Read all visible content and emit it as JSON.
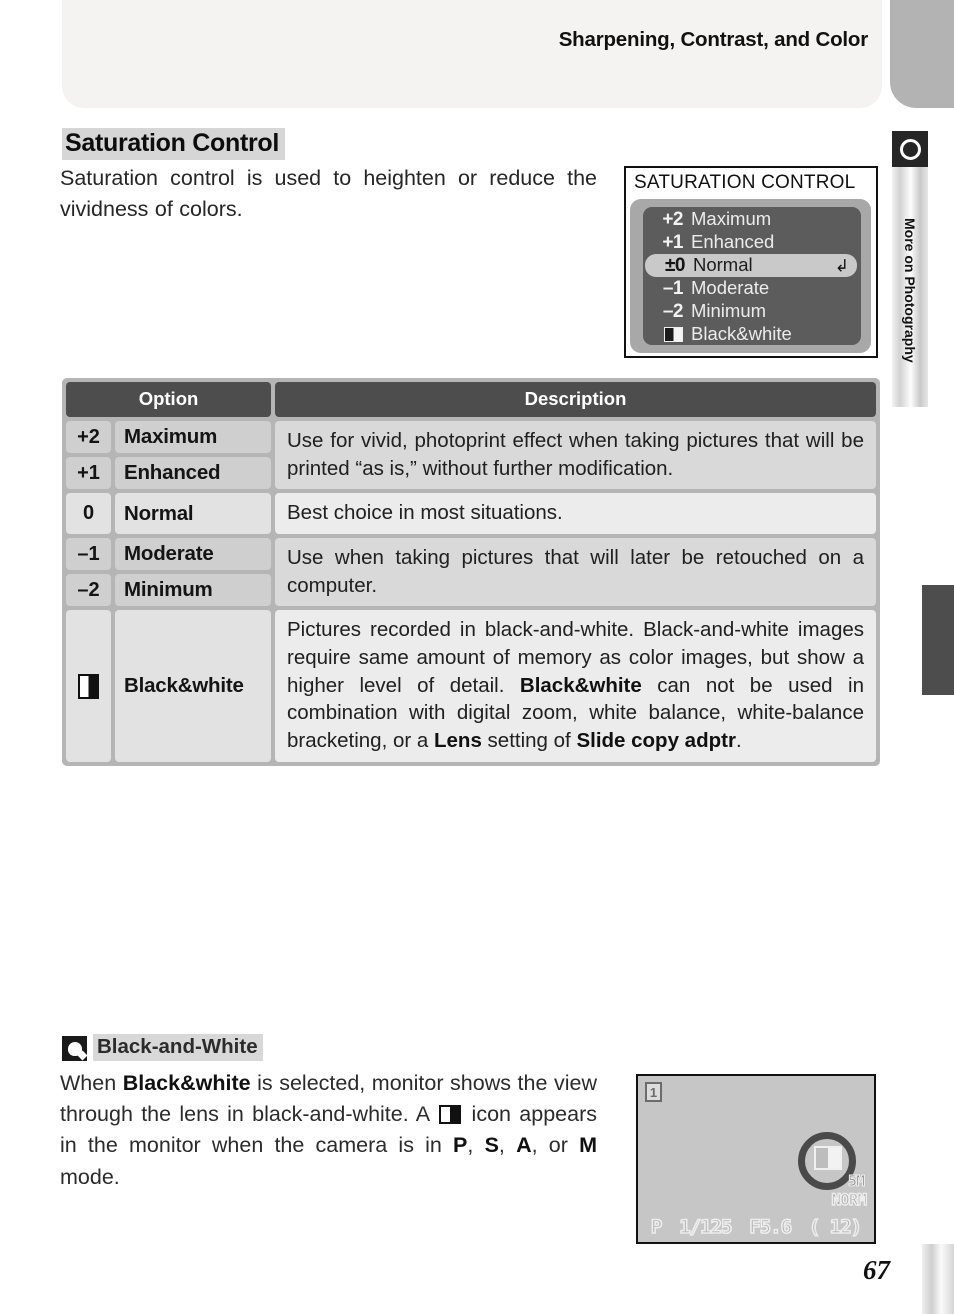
{
  "header": {
    "running_title": "Sharpening, Contrast, and Color"
  },
  "side_tab": {
    "label": "More on Photography",
    "icon": "lens-ring-icon"
  },
  "section": {
    "heading": "Saturation Control",
    "intro": "Saturation control is used to heighten or reduce the vividness of colors."
  },
  "menu_screenshot": {
    "title": "SATURATION CONTROL",
    "rows": [
      {
        "value": "+2",
        "label": "Maximum",
        "selected": false
      },
      {
        "value": "+1",
        "label": "Enhanced",
        "selected": false
      },
      {
        "value": "±0",
        "label": "Normal",
        "selected": true,
        "enter_arrow": "↲"
      },
      {
        "value": "–1",
        "label": "Moderate",
        "selected": false
      },
      {
        "value": "–2",
        "label": "Minimum",
        "selected": false
      },
      {
        "value": "",
        "label": "Black&white",
        "selected": false,
        "icon": "black-and-white-swatch-icon"
      }
    ]
  },
  "table": {
    "headers": {
      "option": "Option",
      "description": "Description"
    },
    "groups": [
      {
        "options": [
          {
            "value": "+2",
            "name": "Maximum"
          },
          {
            "value": "+1",
            "name": "Enhanced"
          }
        ],
        "description": "Use for vivid, photoprint effect when taking pictures that will be printed “as is,” without further modification.",
        "shade": "dark"
      },
      {
        "options": [
          {
            "value": "0",
            "name": "Normal"
          }
        ],
        "description": "Best choice in most situations.",
        "shade": "light"
      },
      {
        "options": [
          {
            "value": "–1",
            "name": "Moderate"
          },
          {
            "value": "–2",
            "name": "Minimum"
          }
        ],
        "description": "Use when taking pictures that will later be retouched on a computer.",
        "shade": "dark"
      },
      {
        "options": [
          {
            "value": "",
            "name": "Black&white",
            "icon": "black-and-white-swatch-icon"
          }
        ],
        "description_html": "Pictures recorded in black-and-white.  Black-and-white images require same amount of memory as color images, but show a higher level of detail.  <b>Black&amp;white</b> can not be used in combination with digital zoom, white balance, white-balance bracketing, or a <b>Lens</b> setting of <b>Slide copy adptr</b>.",
        "shade": "light"
      }
    ]
  },
  "note": {
    "icon": "tip-lightbulb-icon",
    "heading": "Black-and-White",
    "body_html": "When <b>Black&amp;white</b> is selected, monitor shows the view through the lens in black-and-white.  A <span class=\"bw-inline\" data-name=\"black-and-white-swatch-icon\" data-interactable=\"false\"></span> icon appears in the monitor when the camera is in <b>P</b>, <b>S</b>, <b>A</b>, or <b>M</b> mode."
  },
  "monitor_screenshot": {
    "frame_badge": "1",
    "bw_indicator": "black-and-white-icon",
    "image_size": "5M",
    "image_quality": "NORM",
    "status": {
      "mode": "P",
      "shutter_speed": "1/125",
      "aperture": "F5.6",
      "frames_remaining": "(  12)"
    }
  },
  "page_number": "67"
}
